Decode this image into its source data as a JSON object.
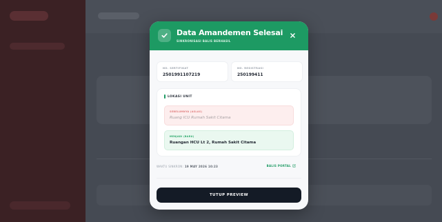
{
  "modal": {
    "title": "Data Amandemen Selesai",
    "subtitle": "SINKRONISASI BALIS BERHASIL",
    "certificate": {
      "label": "NO. SERTIFIKAT",
      "value": "2501991107219"
    },
    "registration": {
      "label": "NO. REGISTRASI",
      "value": "250199411"
    },
    "location": {
      "title": "LOKASI UNIT",
      "old_label": "SEBELUMNYA (ASLAS)",
      "old_value": "Ruang ICU Rumah Sakit Citama",
      "new_label": "MENJADI (BARU)",
      "new_value": "Ruangan HCU Lt 2, Rumah Sakit Citama"
    },
    "sync_label": "WAKTU SINKRON:",
    "sync_time": "19 MAY 2026 10:23",
    "portal_link": "BALIS PORTAL",
    "close_button": "TUTUP PREVIEW"
  },
  "colors": {
    "header_green": "#1d9a63",
    "button_dark": "#141b26",
    "old_bg": "#fdeeee",
    "new_bg": "#eaf8f0"
  },
  "icons": {
    "header": "check-icon",
    "close": "close-icon",
    "link": "external-link-icon"
  }
}
